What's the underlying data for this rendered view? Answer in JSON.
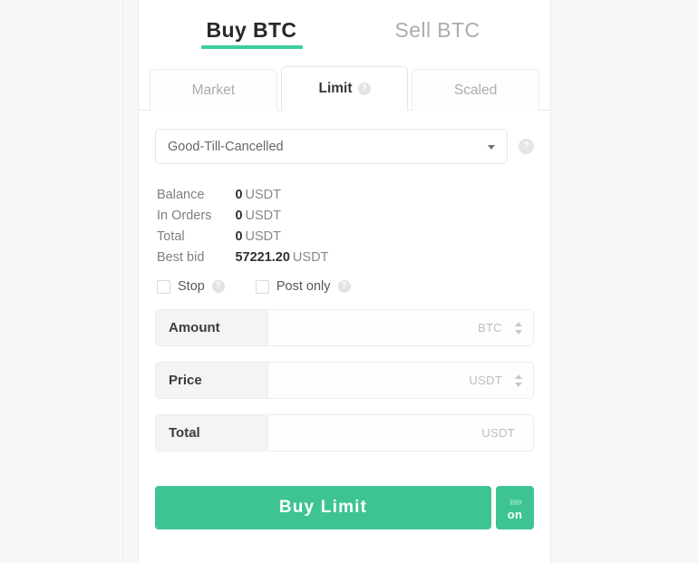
{
  "side_tabs": [
    {
      "label": "Buy BTC",
      "active": true
    },
    {
      "label": "Sell BTC",
      "active": false
    }
  ],
  "order_type_tabs": [
    {
      "label": "Market",
      "active": false,
      "has_help": false
    },
    {
      "label": "Limit",
      "active": true,
      "has_help": true
    },
    {
      "label": "Scaled",
      "active": false,
      "has_help": false
    }
  ],
  "time_in_force": {
    "value": "Good-Till-Cancelled",
    "caret_icon": "chevron-down-icon",
    "help_icon": "help-circle-icon",
    "help_glyph": "?"
  },
  "balances": {
    "rows": [
      {
        "label": "Balance",
        "value": "0",
        "currency": "USDT"
      },
      {
        "label": "In Orders",
        "value": "0",
        "currency": "USDT"
      },
      {
        "label": "Total",
        "value": "0",
        "currency": "USDT"
      },
      {
        "label": "Best bid",
        "value": "57221.20",
        "currency": "USDT"
      }
    ]
  },
  "options": [
    {
      "label": "Stop",
      "checked": false,
      "help_glyph": "?"
    },
    {
      "label": "Post only",
      "checked": false,
      "help_glyph": "?"
    }
  ],
  "fields": [
    {
      "label": "Amount",
      "value": "",
      "placeholder": "",
      "unit": "BTC",
      "spinner": true
    },
    {
      "label": "Price",
      "value": "",
      "placeholder": "",
      "unit": "USDT",
      "spinner": true
    },
    {
      "label": "Total",
      "value": "",
      "placeholder": "",
      "unit": "USDT",
      "spinner": false
    }
  ],
  "submit": {
    "label": "Buy  Limit",
    "toggle_chevrons": "»»",
    "toggle_state": "on"
  },
  "colors": {
    "accent_green": "#3ec493",
    "underline_green": "#3ecf99",
    "panel_bg": "#ffffff",
    "page_bg": "#f7f7f7",
    "muted_text": "#a9adb2",
    "dark_text": "#2f3135"
  }
}
